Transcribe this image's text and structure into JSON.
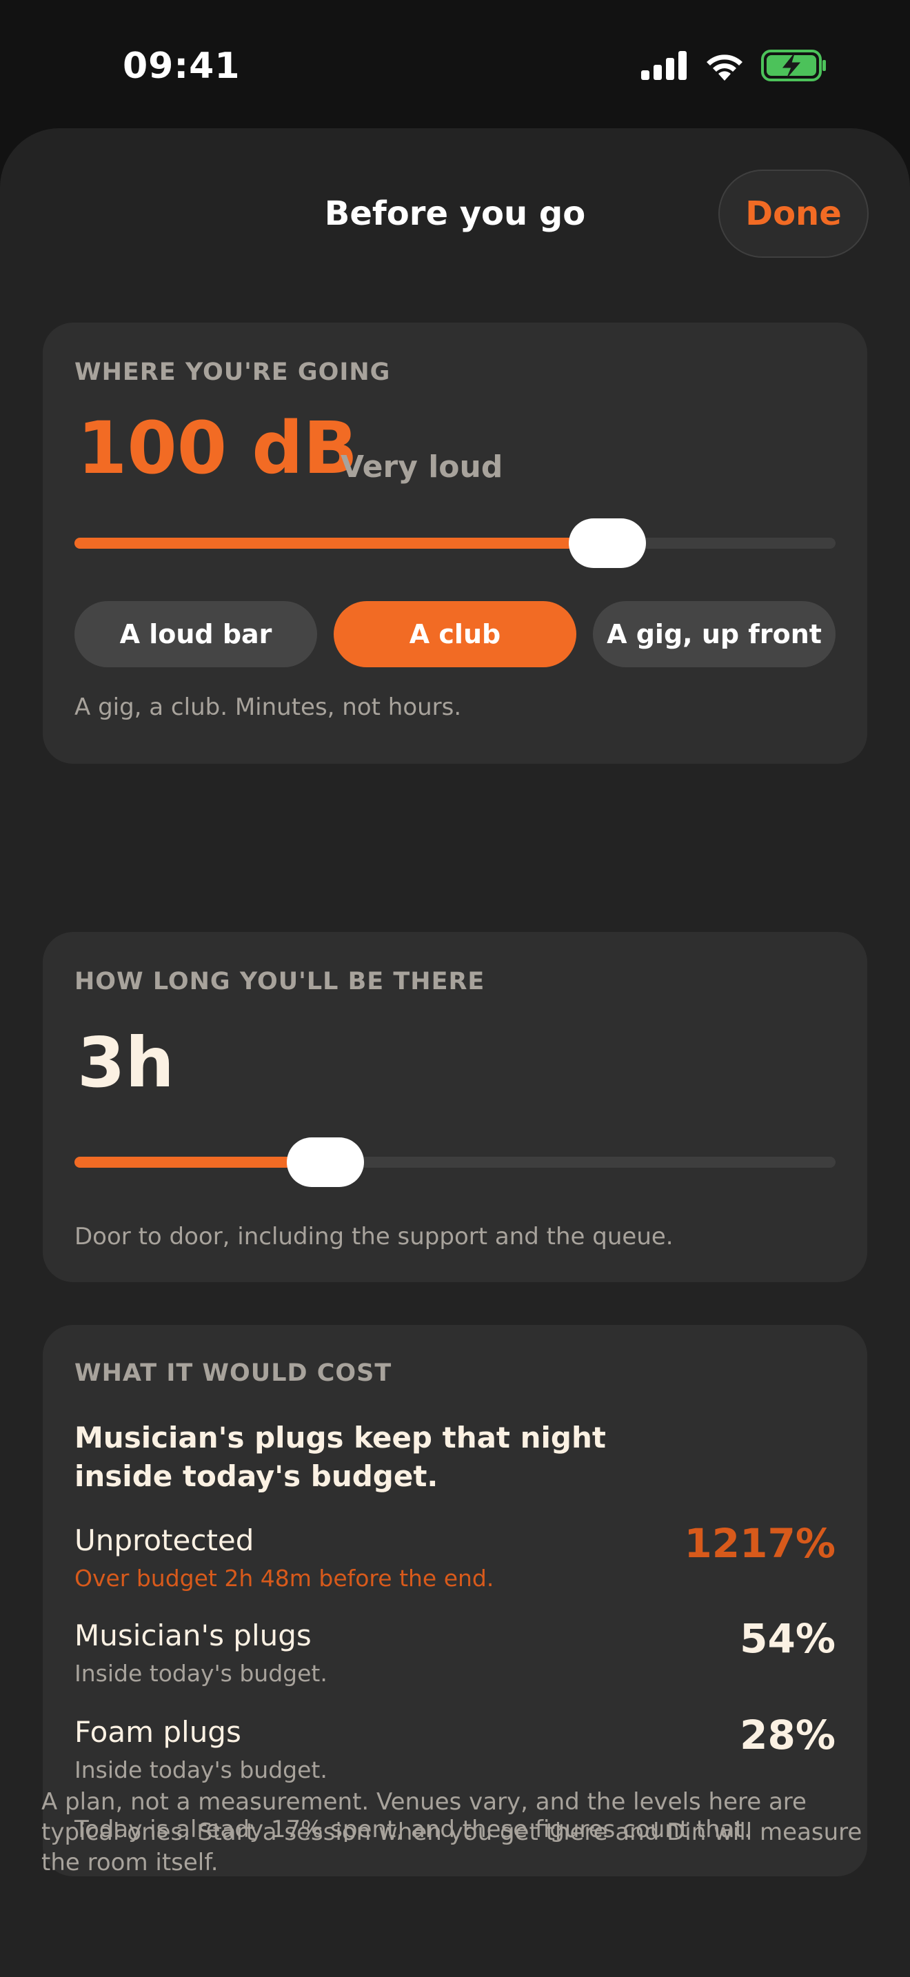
{
  "status_bar": {
    "time": "09:41",
    "icons": [
      "signal-icon",
      "wifi-icon",
      "battery-charging-icon"
    ]
  },
  "colors": {
    "accent": "#f26b24",
    "warning": "#d85a1b",
    "background": "#121212",
    "sheet": "#232323",
    "card": "#2f2f2f"
  },
  "header": {
    "title": "Before you go",
    "done_label": "Done"
  },
  "venue": {
    "label": "WHERE YOU'RE GOING",
    "level": "100 dB",
    "level_description": "Very loud",
    "slider_fraction": 0.7,
    "options": [
      {
        "label": "A loud bar",
        "selected": false
      },
      {
        "label": "A club",
        "selected": true
      },
      {
        "label": "A gig, up front",
        "selected": false
      }
    ],
    "caption": "A gig, a club. Minutes, not hours."
  },
  "duration": {
    "label": "HOW LONG YOU'LL BE THERE",
    "value": "3h",
    "slider_fraction": 0.33,
    "caption": "Door to door, including the support and the queue."
  },
  "cost": {
    "label": "WHAT IT WOULD COST",
    "verdict": "Musician's plugs keep that night inside today's budget.",
    "rows": [
      {
        "name": "Unprotected",
        "detail": "Over budget 2h 48m before the end.",
        "percent": "1217%",
        "over_budget": true
      },
      {
        "name": "Musician's plugs",
        "detail": "Inside today's budget.",
        "percent": "54%",
        "over_budget": false
      },
      {
        "name": "Foam plugs",
        "detail": "Inside today's budget.",
        "percent": "28%",
        "over_budget": false
      }
    ],
    "caption": "Today is already 17% spent, and these figures count that."
  },
  "footnote": "A plan, not a measurement. Venues vary, and the levels here are typical ones. Start a session when you get there and Din will measure the room itself."
}
